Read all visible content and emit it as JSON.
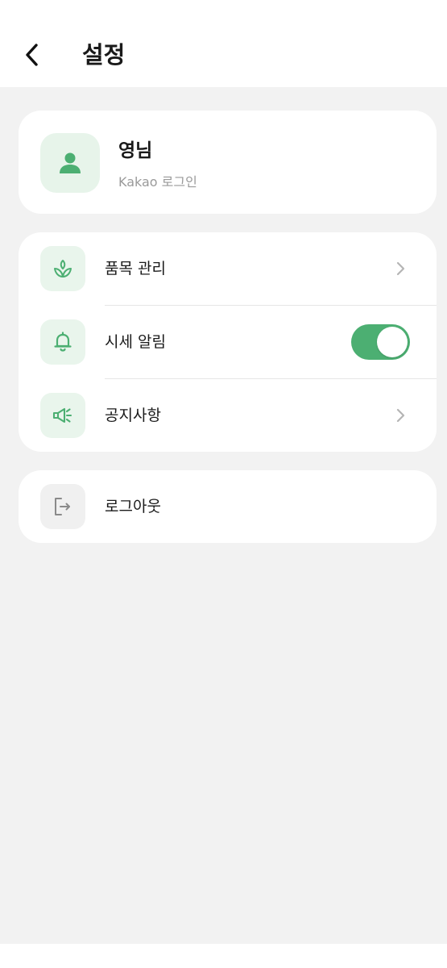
{
  "header": {
    "title": "설정",
    "back_icon": "chevron-left-icon"
  },
  "profile": {
    "name": "영님",
    "login_method": "Kakao 로그인",
    "avatar_icon": "user-icon"
  },
  "menu": {
    "items": [
      {
        "label": "품목 관리",
        "icon": "sprout-icon",
        "control": "chevron"
      },
      {
        "label": "시세 알림",
        "icon": "bell-icon",
        "control": "toggle",
        "toggle_on": true
      },
      {
        "label": "공지사항",
        "icon": "megaphone-icon",
        "control": "chevron"
      }
    ]
  },
  "logout": {
    "label": "로그아웃",
    "icon": "logout-icon"
  },
  "colors": {
    "accent": "#4caf72",
    "icon_bg": "#e9f5ec",
    "background": "#f2f2f2"
  }
}
